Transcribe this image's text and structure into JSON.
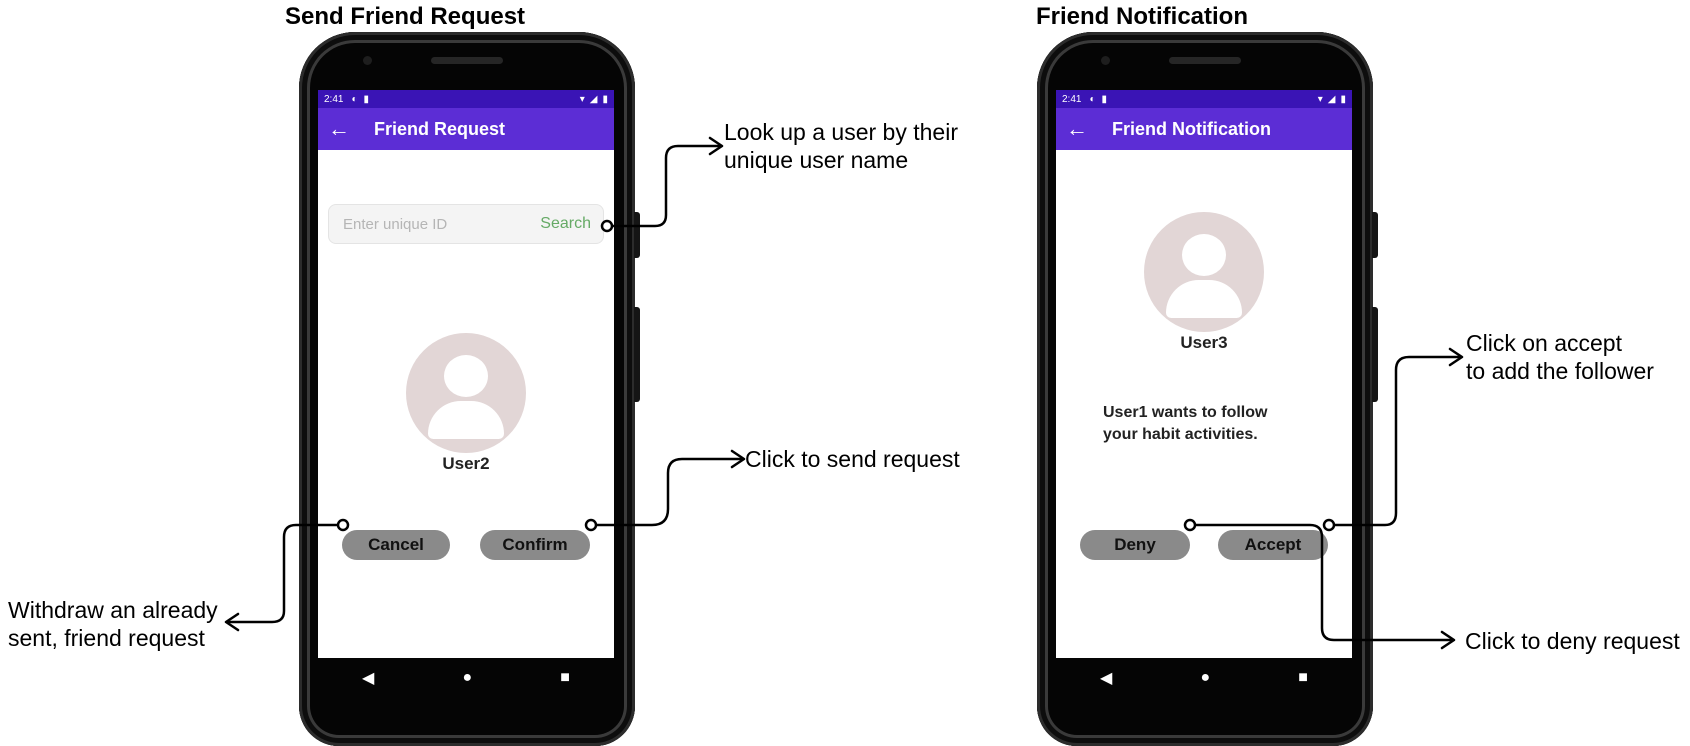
{
  "left_panel": {
    "section_title": "Send Friend Request",
    "status": {
      "time": "2:41"
    },
    "app_bar_title": "Friend Request",
    "search": {
      "placeholder": "Enter unique ID",
      "value": "",
      "button_label": "Search"
    },
    "user_name": "User2",
    "cancel_label": "Cancel",
    "confirm_label": "Confirm"
  },
  "right_panel": {
    "section_title": "Friend Notification",
    "status": {
      "time": "2:41"
    },
    "app_bar_title": "Friend Notification",
    "user_name": "User3",
    "message_line1": "User1 wants to follow",
    "message_line2": "your habit activities.",
    "deny_label": "Deny",
    "accept_label": "Accept"
  },
  "annotations": {
    "lookup_line1": "Look up a user by their",
    "lookup_line2": "unique user name",
    "send_request": "Click to send request",
    "withdraw_line1": "Withdraw an already",
    "withdraw_line2": "sent, friend request",
    "accept_line1": "Click on accept",
    "accept_line2": "to add the follower",
    "deny_request": "Click to deny request"
  },
  "icons": {
    "back": "arrow-left-icon",
    "nav_back": "triangle-back-icon",
    "nav_home": "circle-home-icon",
    "nav_recents": "square-recents-icon",
    "avatar": "person-avatar-icon"
  },
  "colors": {
    "status_bar": "#3a14b5",
    "app_bar": "#5c2dd5",
    "search_accent": "#66aa66",
    "avatar_bg": "#e2d6d6",
    "button_bg": "#8a8a8a"
  }
}
